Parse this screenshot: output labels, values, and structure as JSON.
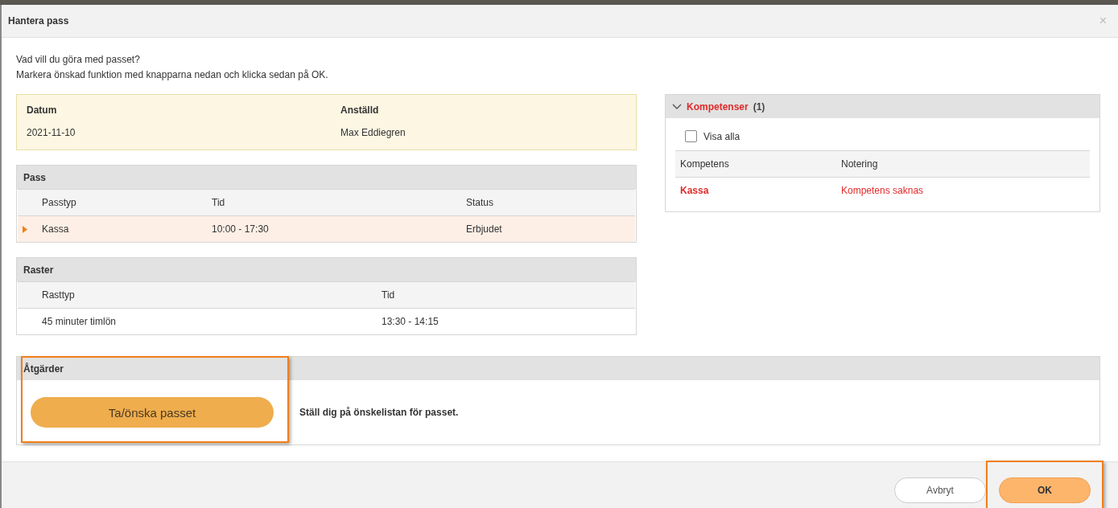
{
  "window": {
    "title": "Hantera pass",
    "close": "×"
  },
  "intro": [
    "Vad vill du göra med passet?",
    "Markera önskad funktion med knapparna nedan och klicka sedan på OK."
  ],
  "summary": [
    {
      "label": "Datum",
      "value": "2021-11-10"
    },
    {
      "label": "Anställd",
      "value": "Max Eddiegren"
    }
  ],
  "pass": {
    "title": "Pass",
    "columns": [
      "Passtyp",
      "Tid",
      "Status"
    ],
    "rows": [
      {
        "cells": [
          "Kassa",
          "10:00 - 17:30",
          "Erbjudet"
        ],
        "selected": true
      }
    ]
  },
  "raster": {
    "title": "Raster",
    "columns": [
      "Rasttyp",
      "Tid"
    ],
    "rows": [
      {
        "cells": [
          "45 minuter timlön",
          "13:30 - 14:15"
        ],
        "selected": false
      }
    ]
  },
  "kompetenser": {
    "title": "Kompetenser",
    "count": "(1)",
    "expanded": true,
    "show_all": {
      "label": "Visa alla",
      "checked": false
    },
    "columns": [
      "Kompetens",
      "Notering"
    ],
    "rows": [
      {
        "cells": [
          "Kassa",
          "Kompetens saknas"
        ],
        "missing": true
      }
    ]
  },
  "actions": {
    "title": "Åtgärder",
    "items": [
      {
        "button": "Ta/önska passet",
        "description": "Ställ dig på önskelistan för passet.",
        "highlighted": true
      }
    ]
  },
  "footer": {
    "buttons": [
      {
        "label": "Avbryt",
        "kind": "secondary",
        "highlighted": false
      },
      {
        "label": "OK",
        "kind": "primary",
        "highlighted": true
      }
    ]
  }
}
